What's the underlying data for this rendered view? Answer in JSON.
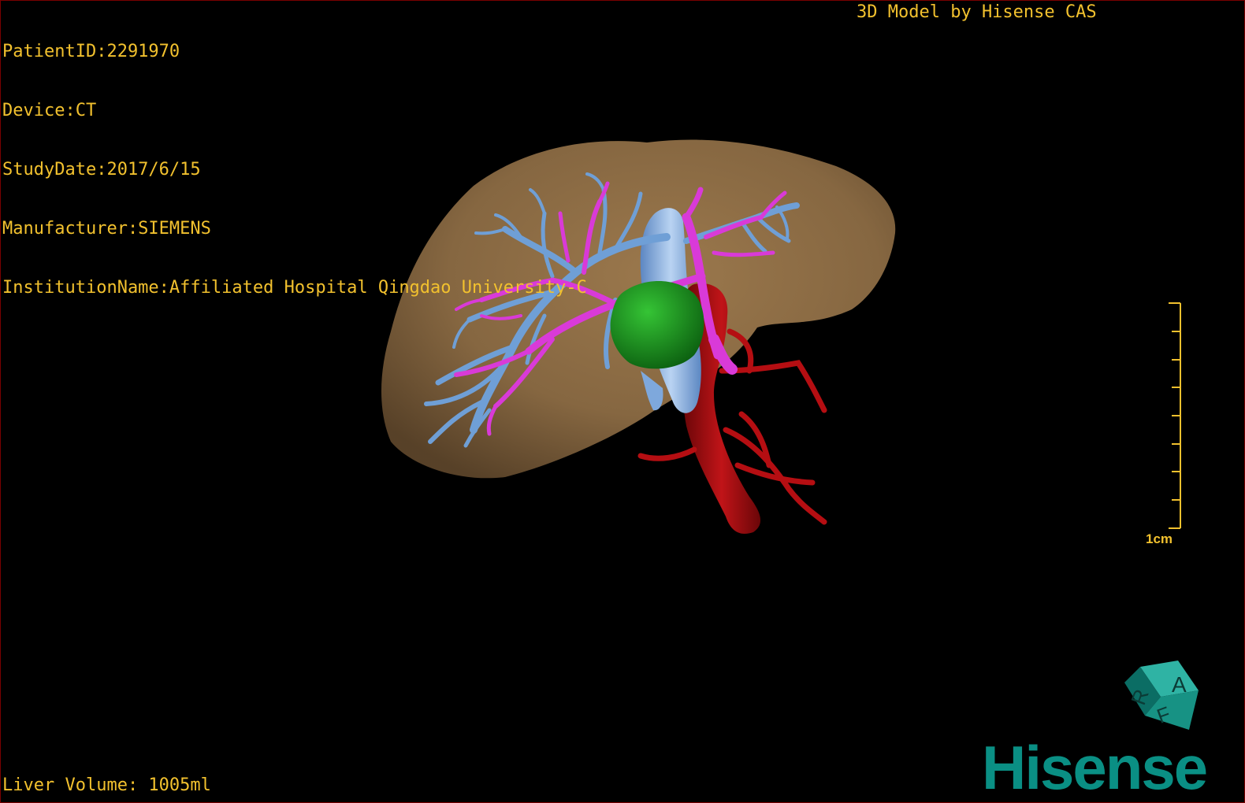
{
  "overlay": {
    "patient_id": "PatientID:2291970",
    "device": "Device:CT",
    "study_date": "StudyDate:2017/6/15",
    "manufacturer": "Manufacturer:SIEMENS",
    "institution": "InstitutionName:Affiliated Hospital Qingdao University-C",
    "brand_title": "3D Model by Hisense CAS",
    "liver_volume": "Liver Volume: 1005ml"
  },
  "scale_bar": {
    "label": "1cm"
  },
  "logo": {
    "text": "Hisense"
  },
  "orientation_cube": {
    "faces": [
      "A",
      "R",
      "F"
    ]
  },
  "colors": {
    "background": "#000000",
    "overlay_text": "#f2c12e",
    "liver": "#8a6a43",
    "hepatic_vein": "#6f9fd6",
    "portal_vein": "#d93ad8",
    "tumor": "#1f9a1f",
    "aorta": "#b00f12",
    "ivc": "#8fb8e8",
    "logo": "#0a8f84",
    "border": "#7a0000"
  }
}
